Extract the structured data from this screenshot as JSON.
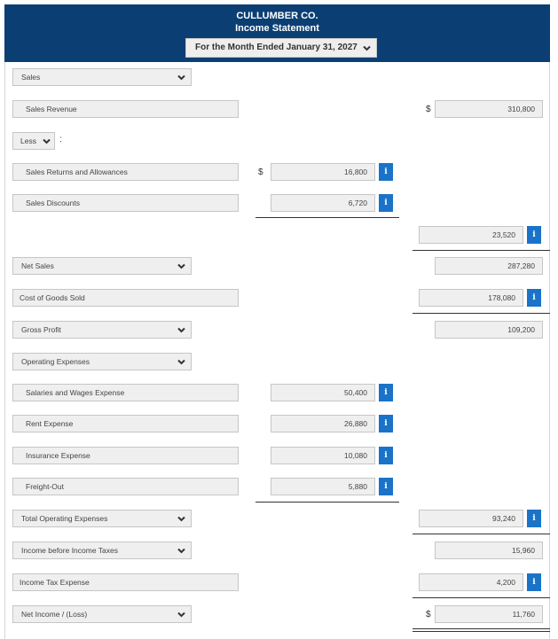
{
  "header": {
    "company": "CULLUMBER CO.",
    "statement": "Income Statement",
    "period": "For the Month Ended January 31, 2027"
  },
  "rows": {
    "sales_heading": "Sales",
    "sales_revenue": {
      "label": "Sales Revenue",
      "amount": "310,800"
    },
    "less": "Less",
    "sales_returns": {
      "label": "Sales Returns and Allowances",
      "amount": "16,800"
    },
    "sales_discounts": {
      "label": "Sales Discounts",
      "amount": "6,720"
    },
    "total_deductions": {
      "amount": "23,520"
    },
    "net_sales": {
      "label": "Net Sales",
      "amount": "287,280"
    },
    "cogs": {
      "label": "Cost of Goods Sold",
      "amount": "178,080"
    },
    "gross_profit": {
      "label": "Gross Profit",
      "amount": "109,200"
    },
    "operating_heading": "Operating Expenses",
    "salaries": {
      "label": "Salaries and Wages Expense",
      "amount": "50,400"
    },
    "rent": {
      "label": "Rent Expense",
      "amount": "26,880"
    },
    "insurance": {
      "label": "Insurance Expense",
      "amount": "10,080"
    },
    "freight": {
      "label": "Freight-Out",
      "amount": "5,880"
    },
    "total_operating": {
      "label": "Total Operating Expenses",
      "amount": "93,240"
    },
    "income_before_taxes": {
      "label": "Income before Income Taxes",
      "amount": "15,960"
    },
    "income_tax": {
      "label": "Income Tax Expense",
      "amount": "4,200"
    },
    "net_income": {
      "label": "Net Income / (Loss)",
      "amount": "11,760"
    }
  },
  "symbols": {
    "dollar": "$",
    "colon": ":",
    "info": "i"
  },
  "colors": {
    "header_bg": "#0b3f73",
    "info_button": "#1a73c8",
    "field_bg": "#efefef"
  }
}
